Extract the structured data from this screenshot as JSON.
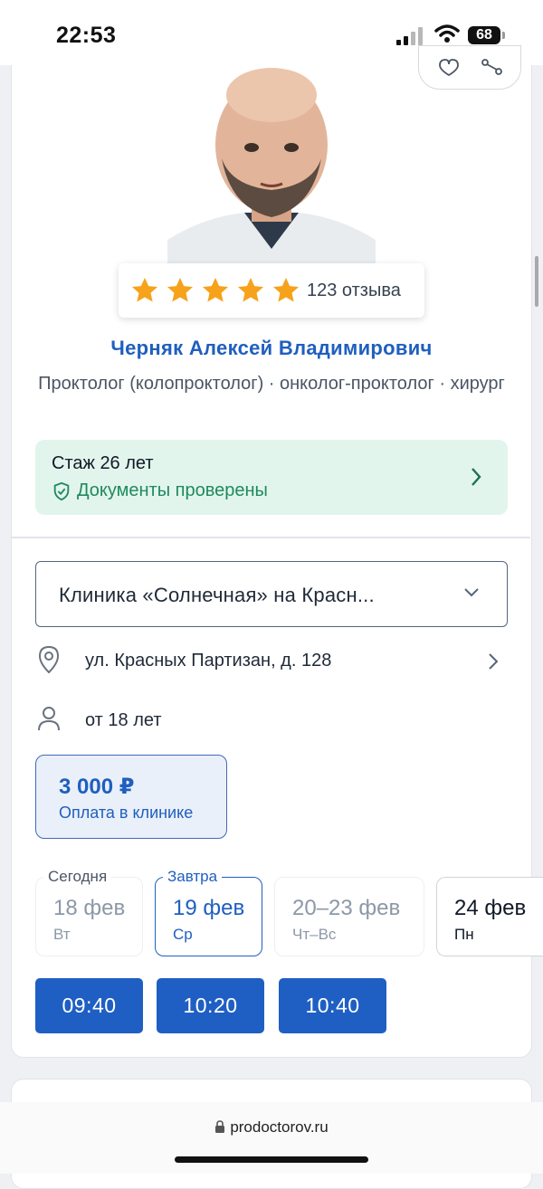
{
  "status_bar": {
    "time": "22:53",
    "battery": "68"
  },
  "doctor": {
    "reviews": "123 отзыва",
    "rating_stars": 5,
    "name": "Черняк Алексей Владимирович",
    "specialties": "Проктолог (колопроктолог) · онколог-проктолог · хирург",
    "experience": "Стаж 26 лет",
    "verified": "Документы проверены"
  },
  "clinic": {
    "selected": "Клиника «Солнечная» на Красн...",
    "address": "ул. Красных Партизан, д. 128",
    "age": "от 18 лет",
    "price": "3 000 ₽",
    "price_note": "Оплата в клинике"
  },
  "dates": [
    {
      "caption": "Сегодня",
      "date": "18 фев",
      "weekday": "Вт"
    },
    {
      "caption": "Завтра",
      "date": "19 фев",
      "weekday": "Ср"
    },
    {
      "caption": "",
      "date": "20–23 фев",
      "weekday": "Чт–Вс"
    },
    {
      "caption": "",
      "date": "24 фев",
      "weekday": "Пн"
    }
  ],
  "times": [
    "09:40",
    "10:20",
    "10:40"
  ],
  "url": "prodoctorov.ru",
  "colors": {
    "primary": "#1f5fc4",
    "link": "#1f5fbf",
    "success_bg": "#e2f5ec",
    "success": "#1f8a5e",
    "star": "#f6a21a"
  }
}
